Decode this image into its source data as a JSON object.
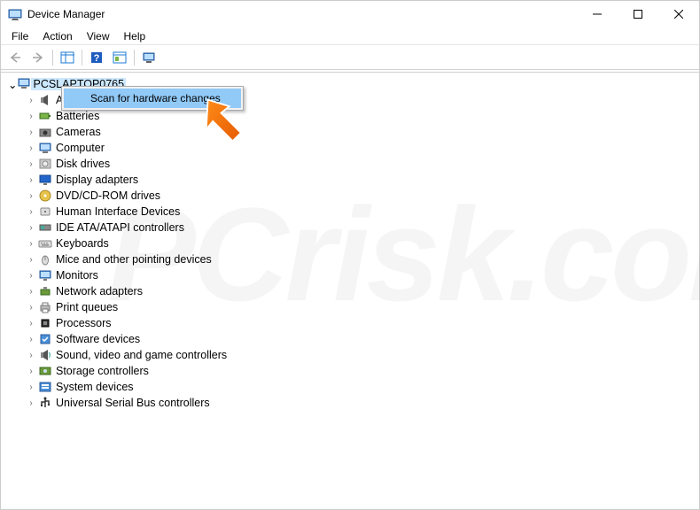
{
  "window": {
    "title": "Device Manager"
  },
  "menu": {
    "file": "File",
    "action": "Action",
    "view": "View",
    "help": "Help"
  },
  "root": {
    "label": "PCSLAPTOP0765"
  },
  "categories": [
    {
      "label": "Audio inputs and outputs",
      "icon": "speaker"
    },
    {
      "label": "Batteries",
      "icon": "battery"
    },
    {
      "label": "Cameras",
      "icon": "camera"
    },
    {
      "label": "Computer",
      "icon": "computer"
    },
    {
      "label": "Disk drives",
      "icon": "disk"
    },
    {
      "label": "Display adapters",
      "icon": "display"
    },
    {
      "label": "DVD/CD-ROM drives",
      "icon": "dvd"
    },
    {
      "label": "Human Interface Devices",
      "icon": "hid"
    },
    {
      "label": "IDE ATA/ATAPI controllers",
      "icon": "ide"
    },
    {
      "label": "Keyboards",
      "icon": "keyboard"
    },
    {
      "label": "Mice and other pointing devices",
      "icon": "mouse"
    },
    {
      "label": "Monitors",
      "icon": "monitor"
    },
    {
      "label": "Network adapters",
      "icon": "network"
    },
    {
      "label": "Print queues",
      "icon": "printer"
    },
    {
      "label": "Processors",
      "icon": "cpu"
    },
    {
      "label": "Software devices",
      "icon": "software"
    },
    {
      "label": "Sound, video and game controllers",
      "icon": "sound"
    },
    {
      "label": "Storage controllers",
      "icon": "storage"
    },
    {
      "label": "System devices",
      "icon": "system"
    },
    {
      "label": "Universal Serial Bus controllers",
      "icon": "usb"
    }
  ],
  "context_menu": {
    "item1": "Scan for hardware changes"
  },
  "watermark": "PCrisk.com"
}
